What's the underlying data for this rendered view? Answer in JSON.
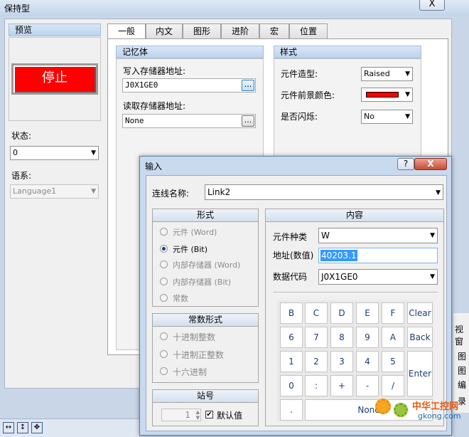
{
  "window": {
    "title": "保持型",
    "close": "X"
  },
  "preview": {
    "header": "预览",
    "stop_button": "停止"
  },
  "state": {
    "label": "状态:",
    "value": "0"
  },
  "language": {
    "label": "语系:",
    "value": "Language1"
  },
  "tabs": [
    "一般",
    "内文",
    "图形",
    "进阶",
    "宏",
    "位置"
  ],
  "memory": {
    "header": "记忆体",
    "write_label": "写入存储器地址:",
    "write_value": "J0X1GE0",
    "read_label": "读取存储器地址:",
    "read_value": "None",
    "browse": "..."
  },
  "style": {
    "header": "样式",
    "shape_label": "元件造型:",
    "shape_value": "Raised",
    "fg_color_label": "元件前景颜色:",
    "fg_color": "#ff0000",
    "blink_label": "是否闪烁:",
    "blink_value": "No"
  },
  "dialog": {
    "title": "输入",
    "help": "?",
    "close": "X",
    "link_label": "连线名称:",
    "link_value": "Link2",
    "form": {
      "header": "形式",
      "options": [
        {
          "label": "元件 (Word)",
          "selected": false,
          "enabled": false
        },
        {
          "label": "元件 (Bit)",
          "selected": true,
          "enabled": true
        },
        {
          "label": "内部存储器 (Word)",
          "selected": false,
          "enabled": false
        },
        {
          "label": "内部存储器 (Bit)",
          "selected": false,
          "enabled": false
        },
        {
          "label": "常数",
          "selected": false,
          "enabled": false
        }
      ]
    },
    "constant_form": {
      "header": "常数形式",
      "options": [
        "十进制整数",
        "十进制正整数",
        "十六进制"
      ]
    },
    "station": {
      "header": "站号",
      "value": "1",
      "default_label": "默认值",
      "default_checked": true
    },
    "content": {
      "header": "内容",
      "type_label": "元件种类",
      "type_value": "W",
      "addr_label": "地址(数值)",
      "addr_value": "40203.1",
      "code_label": "数据代码",
      "code_value": "J0X1GE0"
    },
    "keys": {
      "row1": [
        "B",
        "C",
        "D",
        "E",
        "F",
        "Clear"
      ],
      "row2": [
        "6",
        "7",
        "8",
        "9",
        "A",
        "Back"
      ],
      "row3": [
        "1",
        "2",
        "3",
        "4",
        "5"
      ],
      "row4": [
        "0",
        ":",
        "+",
        "-",
        "/"
      ],
      "enter": "Enter",
      "dot": ".",
      "none": "None"
    }
  },
  "watermark": {
    "text": "中华工控网",
    "url": "gkong.com"
  },
  "side_fragments": [
    "视窗",
    "图",
    "图",
    "编",
    "录"
  ]
}
